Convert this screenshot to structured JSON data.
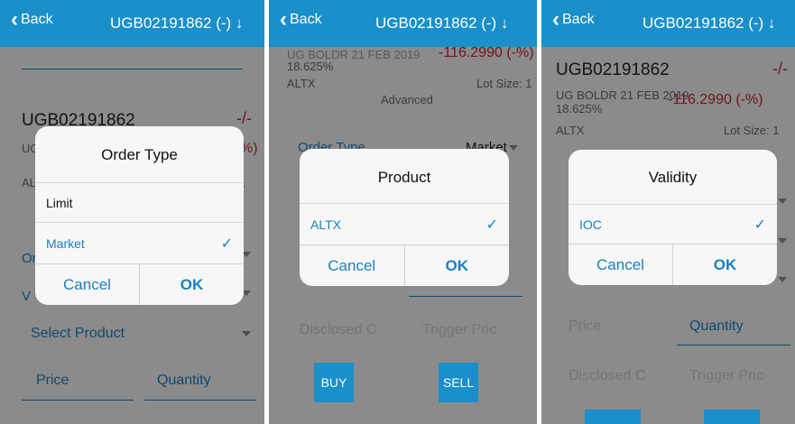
{
  "header": {
    "back_label": "Back",
    "symbol_title": "UGB02191862 (-)"
  },
  "instrument": {
    "symbol": "UGB02191862",
    "change": "-/-",
    "name_line1": "UG BOLDR 21 FEB 2019",
    "name_line2": "18.625%",
    "change_value": "-116.2990 (-%)",
    "exchange": "ALTX",
    "lot_size": "Lot Size: 1",
    "advanced": "Advanced"
  },
  "form": {
    "order_type_label": "Order Type",
    "order_type_value": "Market",
    "select_product": "Select Product",
    "price": "Price",
    "quantity": "Quantity",
    "disclosed": "Disclosed C",
    "trigger": "Trigger Pric",
    "buy": "BUY",
    "sell": "SELL"
  },
  "dialogs": {
    "order_type": {
      "title": "Order Type",
      "options": [
        "Limit",
        "Market"
      ],
      "selected": "Market",
      "cancel": "Cancel",
      "ok": "OK"
    },
    "product": {
      "title": "Product",
      "options": [
        "ALTX"
      ],
      "selected": "ALTX",
      "cancel": "Cancel",
      "ok": "OK"
    },
    "validity": {
      "title": "Validity",
      "options": [
        "IOC"
      ],
      "selected": "IOC",
      "cancel": "Cancel",
      "ok": "OK"
    }
  },
  "colors": {
    "accent": "#1a8fc9",
    "negative": "#c0272d",
    "link": "#1a7fc1"
  },
  "icons": {
    "back": "chevron-left-icon",
    "title_arrow": "arrow-down-icon",
    "check": "checkmark-icon",
    "dropdown": "caret-down-icon"
  }
}
